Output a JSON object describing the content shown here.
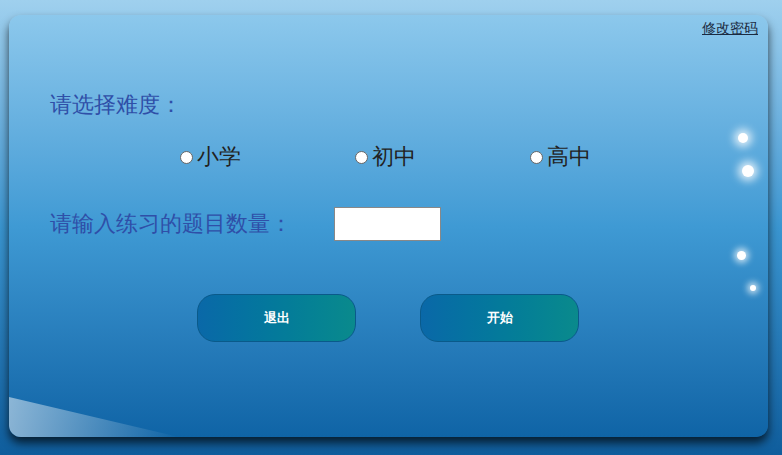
{
  "link": "修改密码",
  "difficulty": {
    "label": "请选择难度：",
    "options": [
      {
        "label": "小学",
        "selected": false
      },
      {
        "label": "初中",
        "selected": false
      },
      {
        "label": "高中",
        "selected": false
      }
    ]
  },
  "count": {
    "label": "请输入练习的题目数量："
  },
  "buttons": [
    "退出",
    "开始"
  ]
}
